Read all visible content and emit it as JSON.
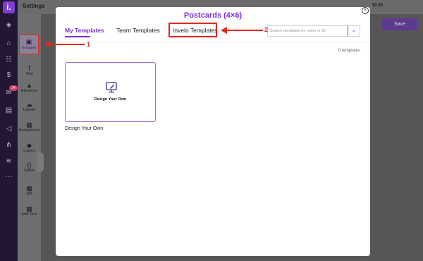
{
  "topbar": {
    "title": "Settings",
    "balance": "$0.00"
  },
  "sidebar": {
    "notification_count": "24"
  },
  "tools": [
    {
      "label": "Templates"
    },
    {
      "label": "Text"
    },
    {
      "label": "Elements"
    },
    {
      "label": "Upload"
    },
    {
      "label": "Background"
    },
    {
      "label": "Layers"
    },
    {
      "label": "Fields"
    },
    {
      "label": "QR"
    },
    {
      "label": "Add On's"
    }
  ],
  "toolbar": {
    "save_label": "Save"
  },
  "modal": {
    "title": "Postcards (4×6)",
    "tabs": [
      {
        "label": "My Templates"
      },
      {
        "label": "Team Templates"
      },
      {
        "label": "Invelo Templates"
      }
    ],
    "search": {
      "placeholder": "Search templates by name or ID"
    },
    "count": "0 templates",
    "card": {
      "label": "Design Your Own",
      "caption": "Design Your Own"
    }
  },
  "annotations": {
    "step1": "1",
    "step2": "2"
  },
  "colors": {
    "accent": "#7b2fd1",
    "annotation": "#e0281f",
    "rail": "#221633"
  }
}
